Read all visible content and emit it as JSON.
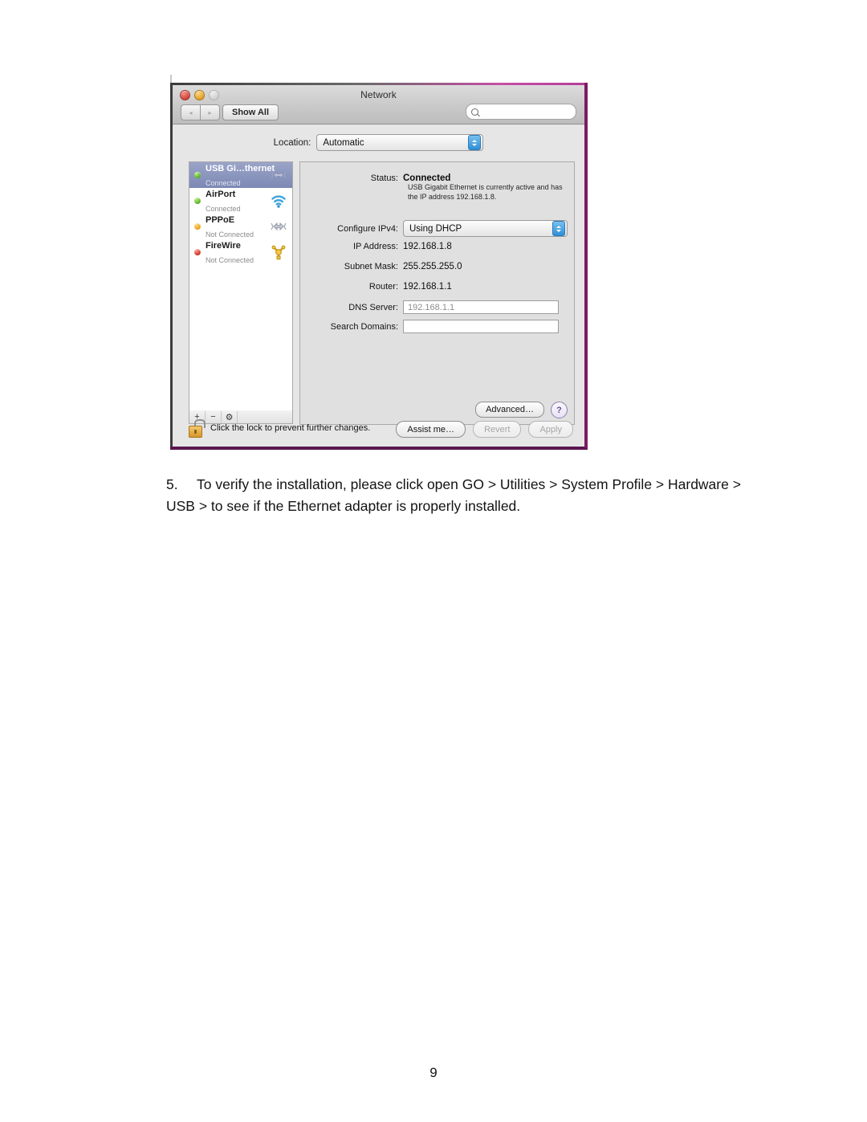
{
  "window": {
    "title": "Network",
    "toolbar": {
      "back_label": "◂",
      "forward_label": "▸",
      "show_all_label": "Show All",
      "search_placeholder": "",
      "search_value": "",
      "search_icon": "search-icon"
    },
    "location": {
      "label": "Location:",
      "value": "Automatic"
    },
    "sidebar": {
      "interfaces": [
        {
          "name": "USB Gi…thernet",
          "status": "Connected",
          "dot": "green",
          "icon": "ethernet-icon",
          "selected": true
        },
        {
          "name": "AirPort",
          "status": "Connected",
          "dot": "green",
          "icon": "wifi-icon",
          "selected": false
        },
        {
          "name": "PPPoE",
          "status": "Not Connected",
          "dot": "orange",
          "icon": "ethernet-icon",
          "selected": false
        },
        {
          "name": "FireWire",
          "status": "Not Connected",
          "dot": "red",
          "icon": "firewire-icon",
          "selected": false
        }
      ],
      "toolbar": {
        "add_label": "+",
        "remove_label": "−",
        "action_label": "⚙"
      }
    },
    "detail": {
      "status_label": "Status:",
      "status_value": "Connected",
      "status_help": "USB Gigabit Ethernet is currently active and has the IP address 192.168.1.8.",
      "configure_label": "Configure IPv4:",
      "configure_value": "Using DHCP",
      "ip_label": "IP Address:",
      "ip_value": "192.168.1.8",
      "subnet_label": "Subnet Mask:",
      "subnet_value": "255.255.255.0",
      "router_label": "Router:",
      "router_value": "192.168.1.1",
      "dns_label": "DNS Server:",
      "dns_value": "192.168.1.1",
      "search_domains_label": "Search Domains:",
      "search_domains_value": "",
      "advanced_label": "Advanced…",
      "help_label": "?"
    },
    "footer": {
      "lock_icon": "unlocked-padlock-icon",
      "lock_text": "Click the lock to prevent further changes.",
      "assist_label": "Assist me…",
      "revert_label": "Revert",
      "apply_label": "Apply"
    }
  },
  "document": {
    "step_number": "5.",
    "step_text": "To verify the installation, please click open GO > Utilities > System Profile > Hardware > USB > to see if the Ethernet adapter is properly installed.",
    "page_number": "9"
  },
  "colors": {
    "selection_blue": "#7d89b4",
    "accent_blue": "#2f8fd8",
    "border_magenta": "#7c1c60",
    "lock_gold": "#d8972a"
  }
}
